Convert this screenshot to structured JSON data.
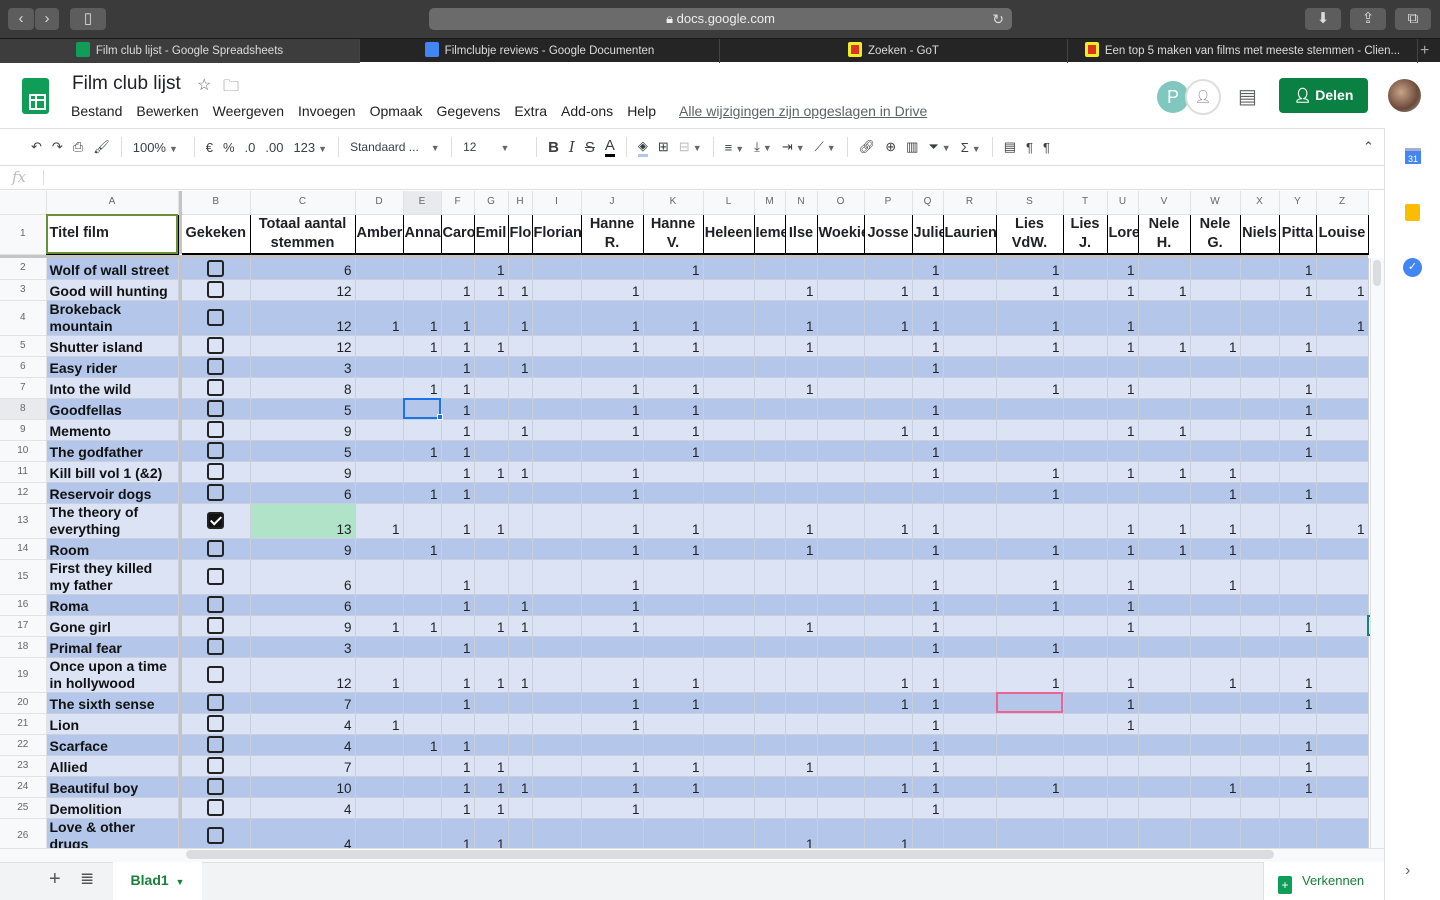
{
  "browser": {
    "url": "docs.google.com",
    "tabs": [
      {
        "label": "Film club lijst - Google Spreadsheets",
        "icon": "sheets-icon",
        "active": true
      },
      {
        "label": "Filmclubje reviews - Google Documenten",
        "icon": "docs-icon",
        "active": false
      },
      {
        "label": "Zoeken - GoT",
        "icon": "got-icon",
        "active": false
      },
      {
        "label": "Een top 5 maken van films met meeste stemmen - Clien...",
        "icon": "got-icon",
        "active": false
      }
    ]
  },
  "header": {
    "title": "Film club lijst",
    "menu": [
      "Bestand",
      "Bewerken",
      "Weergeven",
      "Invoegen",
      "Opmaak",
      "Gegevens",
      "Extra",
      "Add-ons",
      "Help"
    ],
    "saved_status": "Alle wijzigingen zijn opgeslagen in Drive",
    "collaborator_initial": "P",
    "share_label": "Delen",
    "accent_color": "#0b8043"
  },
  "toolbar": {
    "zoom": "100%",
    "currency": "€",
    "percent": "%",
    "dec_less": ".0",
    "dec_more": ".00",
    "more_formats": "123",
    "font": "Standaard ...",
    "font_size": "12",
    "bold": "B",
    "italic": "I",
    "strike": "S",
    "text_color": "A"
  },
  "formula_bar": {
    "fx": "fx",
    "value": ""
  },
  "sheet": {
    "column_letters": [
      "A",
      "B",
      "C",
      "D",
      "E",
      "F",
      "G",
      "H",
      "I",
      "J",
      "K",
      "L",
      "M",
      "N",
      "O",
      "P",
      "Q",
      "R",
      "S",
      "T",
      "U",
      "V",
      "W",
      "X",
      "Y",
      "Z"
    ],
    "headers": {
      "title": "Titel film",
      "watched": "Gekeken",
      "total": "Totaal aantal stemmen",
      "people": [
        "Amber",
        "Anna",
        "Caro",
        "Emil",
        "Flo",
        "Florian",
        "Hanne R.",
        "Hanne V.",
        "Heleen",
        "Ieme",
        "Ilse",
        "Woekie",
        "Josse",
        "Julie",
        "Laurien",
        "Lies VdW.",
        "Lies J.",
        "Lore",
        "Nele H.",
        "Nele G.",
        "Niels",
        "Pitta",
        "Louise"
      ]
    },
    "selected_cell": "E8",
    "collaborator_cell": "S20",
    "rows": [
      {
        "n": "2",
        "title": "Wolf of wall street",
        "checked": false,
        "total": "6",
        "votes": [
          0,
          0,
          0,
          1,
          0,
          0,
          0,
          1,
          0,
          0,
          0,
          0,
          0,
          1,
          0,
          1,
          0,
          1,
          0,
          0,
          0,
          1,
          0
        ]
      },
      {
        "n": "3",
        "title": "Good will hunting",
        "checked": false,
        "total": "12",
        "votes": [
          0,
          0,
          1,
          1,
          1,
          0,
          1,
          0,
          0,
          0,
          1,
          0,
          1,
          1,
          0,
          1,
          0,
          1,
          1,
          0,
          0,
          1,
          1
        ]
      },
      {
        "n": "4",
        "title": "Brokeback mountain",
        "checked": false,
        "total": "12",
        "votes": [
          1,
          1,
          1,
          0,
          1,
          0,
          1,
          1,
          0,
          0,
          1,
          0,
          1,
          1,
          0,
          1,
          0,
          1,
          0,
          0,
          0,
          0,
          1
        ]
      },
      {
        "n": "5",
        "title": "Shutter island",
        "checked": false,
        "total": "12",
        "votes": [
          0,
          1,
          1,
          1,
          0,
          0,
          1,
          1,
          0,
          0,
          1,
          0,
          0,
          1,
          0,
          1,
          0,
          1,
          1,
          1,
          0,
          1,
          0
        ]
      },
      {
        "n": "6",
        "title": "Easy rider",
        "checked": false,
        "total": "3",
        "votes": [
          0,
          0,
          1,
          0,
          1,
          0,
          0,
          0,
          0,
          0,
          0,
          0,
          0,
          1,
          0,
          0,
          0,
          0,
          0,
          0,
          0,
          0,
          0
        ]
      },
      {
        "n": "7",
        "title": "Into the wild",
        "checked": false,
        "total": "8",
        "votes": [
          0,
          1,
          1,
          0,
          0,
          0,
          1,
          1,
          0,
          0,
          1,
          0,
          0,
          0,
          0,
          1,
          0,
          1,
          0,
          0,
          0,
          1,
          0
        ]
      },
      {
        "n": "8",
        "title": "Goodfellas",
        "checked": false,
        "total": "5",
        "votes": [
          0,
          0,
          1,
          0,
          0,
          0,
          1,
          1,
          0,
          0,
          0,
          0,
          0,
          1,
          0,
          0,
          0,
          0,
          0,
          0,
          0,
          1,
          0
        ]
      },
      {
        "n": "9",
        "title": "Memento",
        "checked": false,
        "total": "9",
        "votes": [
          0,
          0,
          1,
          0,
          1,
          0,
          1,
          1,
          0,
          0,
          0,
          0,
          1,
          1,
          0,
          0,
          0,
          1,
          1,
          0,
          0,
          1,
          0
        ]
      },
      {
        "n": "10",
        "title": "The godfather",
        "checked": false,
        "total": "5",
        "votes": [
          0,
          1,
          1,
          0,
          0,
          0,
          0,
          1,
          0,
          0,
          0,
          0,
          0,
          1,
          0,
          0,
          0,
          0,
          0,
          0,
          0,
          1,
          0
        ]
      },
      {
        "n": "11",
        "title": "Kill bill vol 1 (&2)",
        "checked": false,
        "total": "9",
        "votes": [
          0,
          0,
          1,
          1,
          1,
          0,
          1,
          0,
          0,
          0,
          0,
          0,
          0,
          1,
          0,
          1,
          0,
          1,
          1,
          1,
          0,
          0,
          0
        ]
      },
      {
        "n": "12",
        "title": "Reservoir dogs",
        "checked": false,
        "total": "6",
        "votes": [
          0,
          1,
          1,
          0,
          0,
          0,
          1,
          0,
          0,
          0,
          0,
          0,
          0,
          0,
          0,
          1,
          0,
          0,
          0,
          1,
          0,
          1,
          0
        ]
      },
      {
        "n": "13",
        "title": "The theory of everything",
        "checked": true,
        "total": "13",
        "votes": [
          1,
          0,
          1,
          1,
          0,
          0,
          1,
          1,
          0,
          0,
          1,
          0,
          1,
          1,
          0,
          0,
          0,
          1,
          1,
          1,
          0,
          1,
          1
        ]
      },
      {
        "n": "14",
        "title": "Room",
        "checked": false,
        "total": "9",
        "votes": [
          0,
          1,
          0,
          0,
          0,
          0,
          1,
          1,
          0,
          0,
          1,
          0,
          0,
          1,
          0,
          1,
          0,
          1,
          1,
          1,
          0,
          0,
          0
        ]
      },
      {
        "n": "15",
        "title": "First they killed my father",
        "checked": false,
        "total": "6",
        "votes": [
          0,
          0,
          1,
          0,
          0,
          0,
          1,
          0,
          0,
          0,
          0,
          0,
          0,
          1,
          0,
          1,
          0,
          1,
          0,
          1,
          0,
          0,
          0
        ]
      },
      {
        "n": "16",
        "title": "Roma",
        "checked": false,
        "total": "6",
        "votes": [
          0,
          0,
          1,
          0,
          1,
          0,
          1,
          0,
          0,
          0,
          0,
          0,
          0,
          1,
          0,
          1,
          0,
          1,
          0,
          0,
          0,
          0,
          0
        ]
      },
      {
        "n": "17",
        "title": "Gone girl",
        "checked": false,
        "total": "9",
        "votes": [
          1,
          1,
          0,
          1,
          1,
          0,
          1,
          0,
          0,
          0,
          1,
          0,
          0,
          1,
          0,
          0,
          0,
          1,
          0,
          0,
          0,
          1,
          0
        ]
      },
      {
        "n": "18",
        "title": "Primal fear",
        "checked": false,
        "total": "3",
        "votes": [
          0,
          0,
          1,
          0,
          0,
          0,
          0,
          0,
          0,
          0,
          0,
          0,
          0,
          1,
          0,
          1,
          0,
          0,
          0,
          0,
          0,
          0,
          0
        ]
      },
      {
        "n": "19",
        "title": "Once upon a time in hollywood",
        "checked": false,
        "total": "12",
        "votes": [
          1,
          0,
          1,
          1,
          1,
          0,
          1,
          1,
          0,
          0,
          0,
          0,
          1,
          1,
          0,
          1,
          0,
          1,
          0,
          1,
          0,
          1,
          0
        ]
      },
      {
        "n": "20",
        "title": "The sixth sense",
        "checked": false,
        "total": "7",
        "votes": [
          0,
          0,
          1,
          0,
          0,
          0,
          1,
          1,
          0,
          0,
          0,
          0,
          1,
          1,
          0,
          0,
          0,
          1,
          0,
          0,
          0,
          1,
          0
        ]
      },
      {
        "n": "21",
        "title": "Lion",
        "checked": false,
        "total": "4",
        "votes": [
          1,
          0,
          0,
          0,
          0,
          0,
          1,
          0,
          0,
          0,
          0,
          0,
          0,
          1,
          0,
          0,
          0,
          1,
          0,
          0,
          0,
          0,
          0
        ]
      },
      {
        "n": "22",
        "title": "Scarface",
        "checked": false,
        "total": "4",
        "votes": [
          0,
          1,
          1,
          0,
          0,
          0,
          0,
          0,
          0,
          0,
          0,
          0,
          0,
          1,
          0,
          0,
          0,
          0,
          0,
          0,
          0,
          1,
          0
        ]
      },
      {
        "n": "23",
        "title": "Allied",
        "checked": false,
        "total": "7",
        "votes": [
          0,
          0,
          1,
          1,
          0,
          0,
          1,
          1,
          0,
          0,
          1,
          0,
          0,
          1,
          0,
          0,
          0,
          0,
          0,
          0,
          0,
          1,
          0
        ]
      },
      {
        "n": "24",
        "title": "Beautiful boy",
        "checked": false,
        "total": "10",
        "votes": [
          0,
          0,
          1,
          1,
          1,
          0,
          1,
          1,
          0,
          0,
          0,
          0,
          1,
          1,
          0,
          1,
          0,
          0,
          0,
          1,
          0,
          1,
          0
        ]
      },
      {
        "n": "25",
        "title": "Demolition",
        "checked": false,
        "total": "4",
        "votes": [
          0,
          0,
          1,
          1,
          0,
          0,
          1,
          0,
          0,
          0,
          0,
          0,
          0,
          1,
          0,
          0,
          0,
          0,
          0,
          0,
          0,
          0,
          0
        ]
      },
      {
        "n": "26",
        "title": "Love & other drugs",
        "checked": false,
        "total": "4",
        "votes": [
          0,
          0,
          1,
          1,
          0,
          0,
          0,
          0,
          0,
          0,
          1,
          0,
          1,
          0,
          0,
          0,
          0,
          0,
          0,
          0,
          0,
          0,
          0
        ]
      }
    ],
    "colors": {
      "band_dark": "#b4c6e9",
      "band_light": "#dbe3f4",
      "highlight": "#b0e3c8"
    }
  },
  "footer": {
    "sheet_tab": "Blad1",
    "explore_label": "Verkennen"
  },
  "side_panel": {
    "calendar_day": "31"
  }
}
